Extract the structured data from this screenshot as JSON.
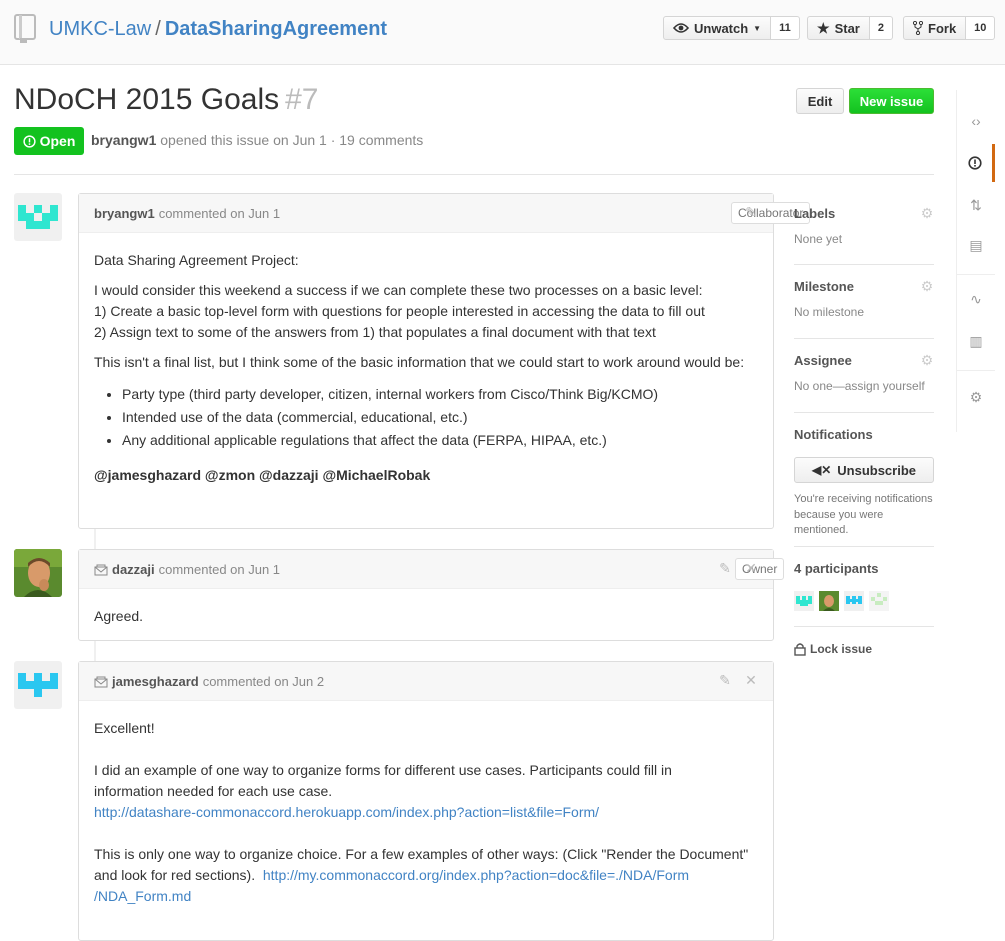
{
  "repo": {
    "owner": "UMKC-Law",
    "separator": "/",
    "name": "DataSharingAgreement"
  },
  "actions": {
    "watch_label": "Unwatch",
    "watch_count": "11",
    "star_label": "Star",
    "star_count": "2",
    "fork_label": "Fork",
    "fork_count": "10"
  },
  "issue": {
    "title": "NDoCH 2015 Goals",
    "number": "#7",
    "edit_label": "Edit",
    "new_issue_label": "New issue",
    "state": "Open",
    "author": "bryangw1",
    "meta_text": "opened this issue on Jun 1 · 19 comments"
  },
  "comments": [
    {
      "author": "bryangw1",
      "action": "commented on Jun 1",
      "role": "Collaborator",
      "intro": "Data Sharing Agreement Project:",
      "para1_line1": "I would consider this weekend a success if we can complete these two processes on a basic level:",
      "para1_line2": "1) Create a basic top-level form with questions for people interested in accessing the data to fill out",
      "para1_line3": "2) Assign text to some of the answers from 1) that populates a final document with that text",
      "para2": "This isn't a final list, but I think some of the basic information that we could start to work around would be:",
      "bullets": [
        "Party type (third party developer, citizen, internal workers from Cisco/Think Big/KCMO)",
        "Intended use of the data (commercial, educational, etc.)",
        "Any additional applicable regulations that affect the data (FERPA, HIPAA, etc.)"
      ],
      "mentions": "@jamesghazard @zmon @dazzaji @MichaelRobak"
    },
    {
      "author": "dazzaji",
      "action": "commented on Jun 1",
      "role": "Owner",
      "body": "Agreed."
    },
    {
      "author": "jamesghazard",
      "action": "commented on Jun 2",
      "line1": "Excellent!",
      "line2": "I did an example of one way to organize forms for different use cases.  Participants could fill in",
      "line3": "information needed for each use case.",
      "link1": "http://datashare-commonaccord.herokuapp.com/index.php?action=list&file=Form/",
      "line4": "This is only one way to organize choice. For a few examples of other ways: (Click \"Render the Document\"",
      "line5": "and look for red sections).",
      "link2a": "http://my.commonaccord.org/index.php?action=doc&file=./NDA/Form",
      "link2b": "/NDA_Form.md"
    }
  ],
  "sidebar": {
    "labels_head": "Labels",
    "labels_val": "None yet",
    "milestone_head": "Milestone",
    "milestone_val": "No milestone",
    "assignee_head": "Assignee",
    "assignee_val": "No one—assign yourself",
    "notifications_head": "Notifications",
    "unsubscribe_label": "Unsubscribe",
    "notifications_note": "You're receiving notifications because you were mentioned.",
    "participants_head": "4 participants",
    "lock_label": "Lock issue"
  },
  "colors": {
    "accent": "#4183c4",
    "open_green": "#13c21f",
    "nav_active": "#d26911"
  },
  "icons": [
    "repo-icon",
    "eye-icon",
    "star-icon",
    "fork-icon",
    "issue-opened-icon",
    "pencil-icon",
    "close-icon",
    "mail-icon",
    "gear-icon",
    "mute-icon",
    "lock-icon",
    "code-icon",
    "pull-request-icon",
    "book-icon",
    "pulse-icon",
    "graph-icon",
    "settings-icon"
  ]
}
